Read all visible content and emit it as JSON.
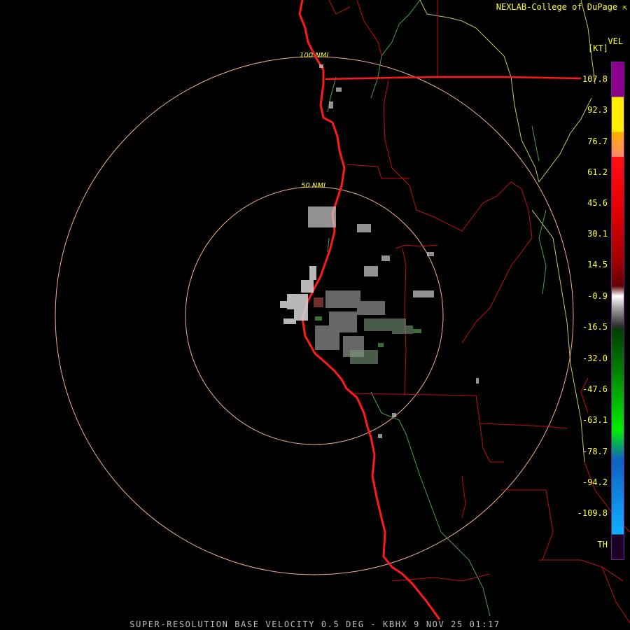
{
  "credit": "NEXLAB-College of DuPage",
  "legend": {
    "product": "VEL",
    "unit": "[KT]",
    "ticks": [
      "107.8",
      "92.3",
      "76.7",
      "61.2",
      "45.6",
      "30.1",
      "14.5",
      "-0.9",
      "-16.5",
      "-32.0",
      "-47.6",
      "-63.1",
      "-78.7",
      "-94.2",
      "-109.8",
      "TH"
    ]
  },
  "rings": {
    "outer_label": "100 NMI",
    "inner_label": "50 NMI"
  },
  "footer": "SUPER-RESOLUTION BASE VELOCITY 0.5 DEG - KBHX 9 NOV 25 01:17",
  "colors": {
    "coastline": "#ff1a1a",
    "county_lines": "#cc1010",
    "state_lines": "#d8d86a",
    "rivers": "#55aa55",
    "range_rings": "#f0b090",
    "labels": "#ffff33"
  }
}
